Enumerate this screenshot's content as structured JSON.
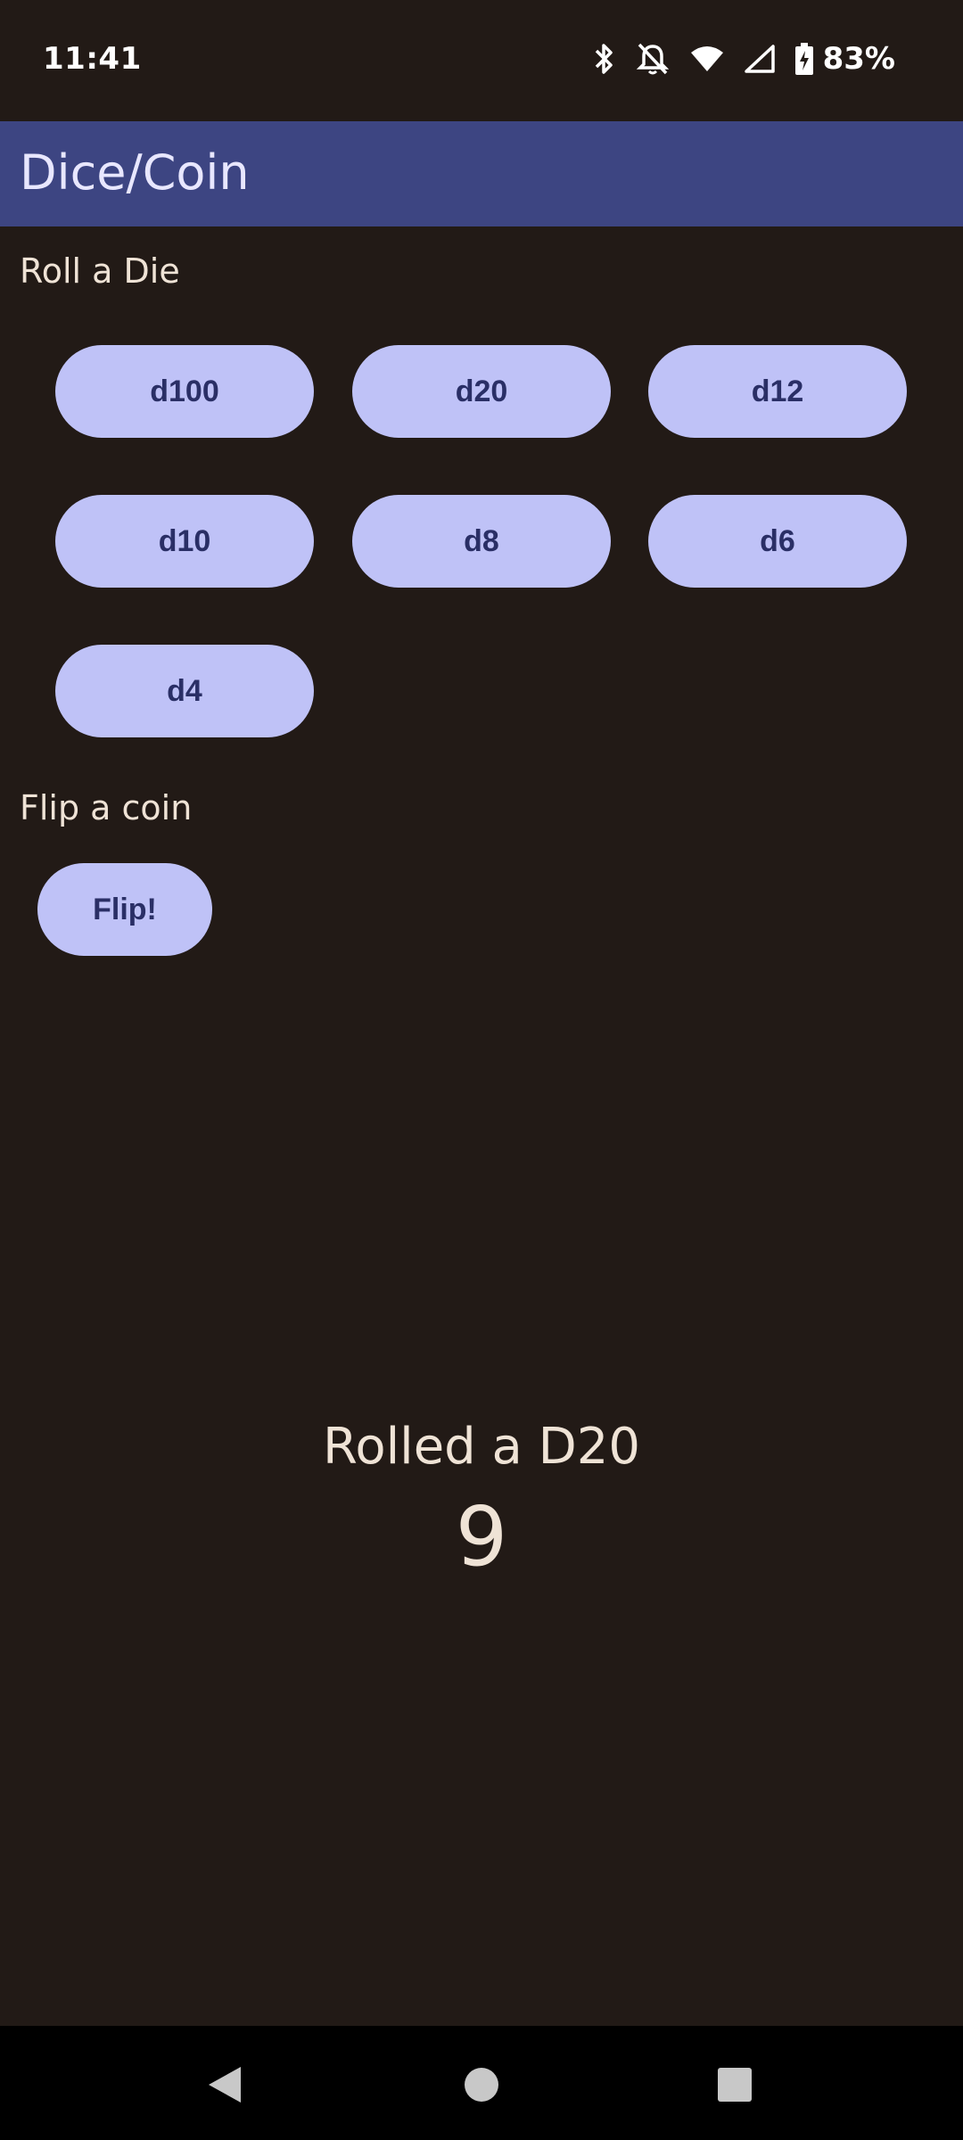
{
  "status_bar": {
    "time": "11:41",
    "battery": "83%",
    "icons": [
      "bluetooth-icon",
      "bell-off-icon",
      "wifi-icon",
      "signal-icon",
      "battery-charging-icon"
    ]
  },
  "app_bar": {
    "title": "Dice/Coin",
    "color": "#3d4582"
  },
  "dice_section": {
    "label": "Roll a Die",
    "buttons": [
      "d100",
      "d20",
      "d12",
      "d10",
      "d8",
      "d6",
      "d4"
    ]
  },
  "coin_section": {
    "label": "Flip a coin",
    "button": "Flip!"
  },
  "result": {
    "title": "Rolled a D20",
    "value": "9"
  },
  "nav_bar": {
    "icons": [
      "back-icon",
      "home-icon",
      "recents-icon"
    ]
  },
  "colors": {
    "background": "#221a16",
    "button": "#bfc2f7",
    "button_text": "#2a2f66",
    "text": "#efe3d6"
  }
}
